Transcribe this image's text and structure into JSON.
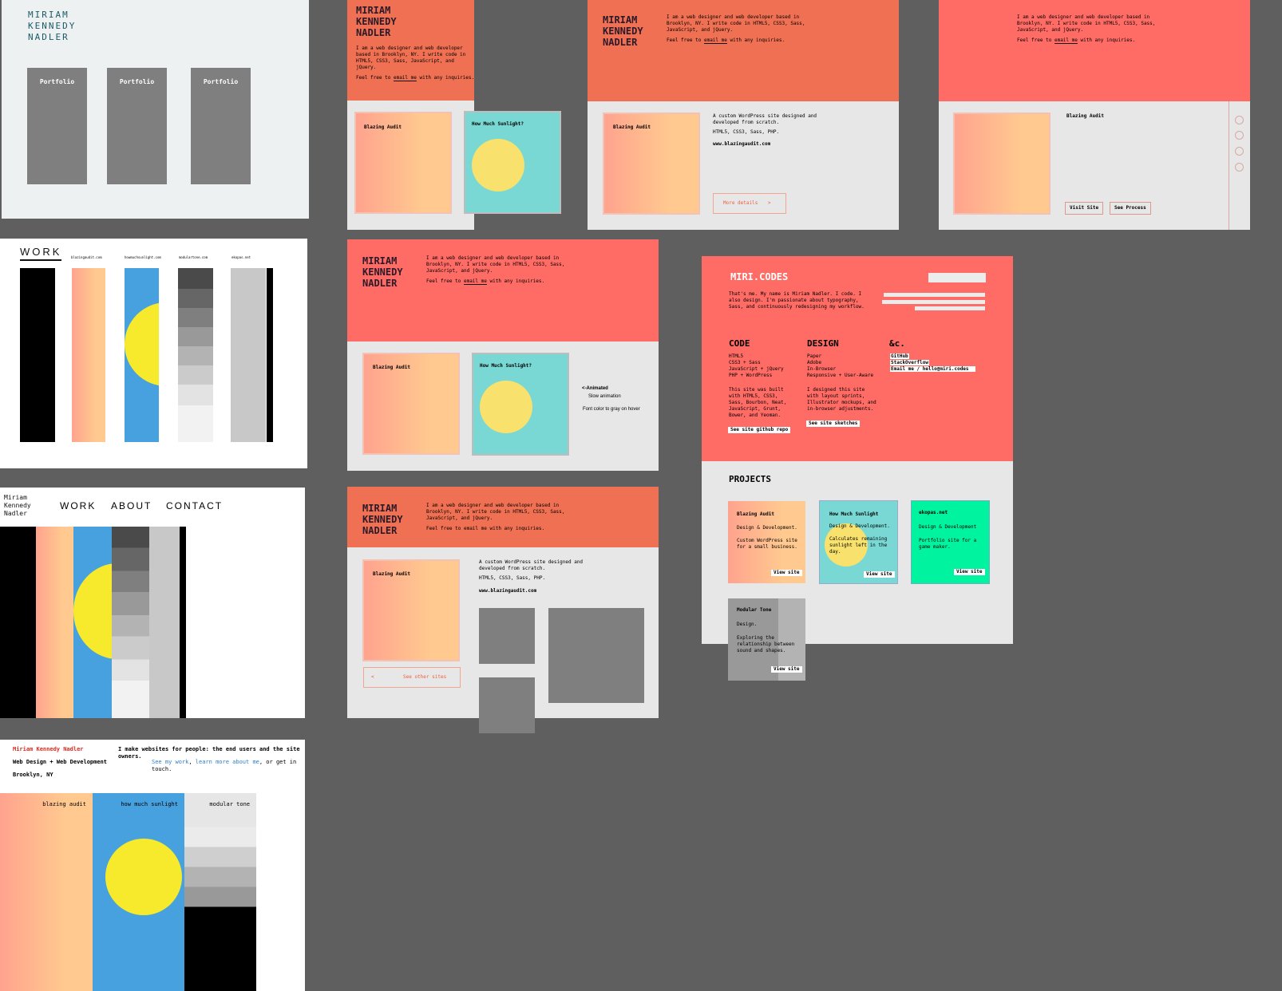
{
  "colors": {
    "canvas": "#5f5f5f",
    "coral": "#ff6b65",
    "orange": "#ef7052",
    "teal": "#79d8d3",
    "yellow": "#f9e16d",
    "mint": "#00f4a0",
    "blue": "#47a1de"
  },
  "common": {
    "name_upper": [
      "MIRIAM",
      "KENNEDY",
      "NADLER"
    ],
    "intro_a": "I am a web designer and web developer based in Brooklyn, NY. I write code in HTML5, CSS3, Sass, JavaScript, and jQuery.",
    "intro_b_pre": "Feel free to ",
    "intro_b_link": "email me",
    "intro_b_post": " with any inquiries.",
    "blazing": "Blazing Audit",
    "sunlight": "How Much Sunlight?",
    "wp_desc": "A custom WordPress site designed and developed from scratch.",
    "tech": "HTML5, CSS3, Sass, PHP.",
    "site_url": "www.blazingaudit.com"
  },
  "f1": {
    "name": [
      "MIRIAM",
      "KENNEDY",
      "NADLER"
    ],
    "portfolio": [
      "Portfolio",
      "Portfolio",
      "Portfolio"
    ]
  },
  "f2": {
    "heading": "WORK",
    "sites": [
      "blazingaudit.com",
      "howmuchsunlight.com",
      "modulartone.com",
      "ekopas.net"
    ]
  },
  "f3": {
    "name": [
      "Miriam",
      "Kennedy",
      "Nadler"
    ],
    "nav": [
      "WORK",
      "ABOUT",
      "CONTACT"
    ]
  },
  "f4": {
    "name": "Miriam Kennedy Nadler",
    "role": "Web Design + Web Development",
    "location": "Brooklyn, NY",
    "tagline": "I make websites for people: the end users and the site owners.",
    "line2_a": "See my work",
    "line2_b": ", ",
    "line2_c": "learn more about me",
    "line2_d": ", or get in touch.",
    "cols": [
      "blazing audit",
      "how much sunlight",
      "modular tone"
    ]
  },
  "f7": {
    "more": "More details",
    "more_arrow": ">"
  },
  "f8": {
    "visit": "Visit Site",
    "process": "See Process"
  },
  "f5": {
    "notes": [
      "<-Animated",
      "Slow animation",
      "Font color to gray on hover"
    ]
  },
  "f6": {
    "back_arrow": "<",
    "see_other": "See other sites"
  },
  "f9": {
    "logo": "MIRI.CODES",
    "intro": "That's me. My name is Miriam Nadler. I code. I also design. I'm passionate about typography, Sass, and continuously redesigning my workflow.",
    "code": {
      "title": "CODE",
      "items": [
        "HTML5",
        "CSS3 + Sass",
        "JavaScript + jQuery",
        "PHP + WordPress"
      ],
      "desc": "This site was built with HTML5, CSS3, Sass, Bourbon, Neat, JavaScript, Grunt, Bower, and Yeoman.",
      "btn": "See site github repo"
    },
    "design": {
      "title": "DESIGN",
      "items": [
        "Paper",
        "Adobe",
        "In-Browser",
        "Responsive + User-Aware"
      ],
      "desc": "I designed this site with layout sprints, Illustrator mockups, and in-browser adjustments.",
      "btn": "See site sketches"
    },
    "etc": {
      "title": "&c.",
      "links": [
        "GitHub",
        "StackOverflow",
        "Email me / hello@miri.codes"
      ]
    },
    "projects_title": "PROJECTS",
    "projects": [
      {
        "title": "Blazing Audit",
        "type": "Design & Development.",
        "desc": "Custom WordPress site for a small business.",
        "btn": "View site"
      },
      {
        "title": "How Much Sunlight",
        "type": "Design & Development.",
        "desc": "Calculates remaining sunlight left in the day.",
        "btn": "View site"
      },
      {
        "title": "ekopas.net",
        "type": "Design & Development",
        "desc": "Portfolio site for a game maker.",
        "btn": "View site"
      },
      {
        "title": "Modular Tone",
        "type": "Design.",
        "desc": "Exploring the relationship between sound and shapes.",
        "btn": "View site"
      }
    ]
  }
}
